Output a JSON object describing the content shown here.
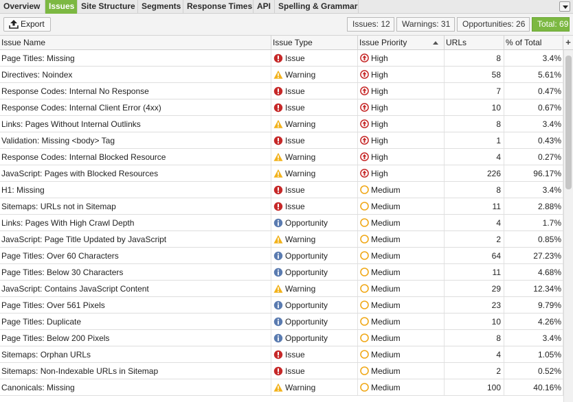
{
  "tabs": [
    {
      "label": "Overview",
      "active": false
    },
    {
      "label": "Issues",
      "active": true
    },
    {
      "label": "Site Structure",
      "active": false
    },
    {
      "label": "Segments",
      "active": false
    },
    {
      "label": "Response Times",
      "active": false
    },
    {
      "label": "API",
      "active": false
    },
    {
      "label": "Spelling & Grammar",
      "active": false
    }
  ],
  "toolbar": {
    "export_label": "Export",
    "counts": {
      "issues": "Issues: 12",
      "warnings": "Warnings: 31",
      "opportunities": "Opportunities: 26",
      "total": "Total: 69"
    }
  },
  "columns": [
    "Issue Name",
    "Issue Type",
    "Issue Priority",
    "URLs",
    "% of Total"
  ],
  "sort": {
    "column": "Issue Priority",
    "direction": "ascending"
  },
  "colors": {
    "accent": "#7cb842",
    "issue": "#c62828",
    "warning": "#f2b21b",
    "opportunity": "#5a7bb0",
    "high": "#c62828",
    "medium": "#f0a818"
  },
  "rows": [
    {
      "name": "Page Titles: Missing",
      "type": "Issue",
      "type_icon": "error-icon",
      "priority": "High",
      "priority_icon": "high-priority-icon",
      "urls": "8",
      "pct": "3.4%"
    },
    {
      "name": "Directives: Noindex",
      "type": "Warning",
      "type_icon": "warning-icon",
      "priority": "High",
      "priority_icon": "high-priority-icon",
      "urls": "58",
      "pct": "5.61%"
    },
    {
      "name": "Response Codes: Internal No Response",
      "type": "Issue",
      "type_icon": "error-icon",
      "priority": "High",
      "priority_icon": "high-priority-icon",
      "urls": "7",
      "pct": "0.47%"
    },
    {
      "name": "Response Codes: Internal Client Error (4xx)",
      "type": "Issue",
      "type_icon": "error-icon",
      "priority": "High",
      "priority_icon": "high-priority-icon",
      "urls": "10",
      "pct": "0.67%"
    },
    {
      "name": "Links: Pages Without Internal Outlinks",
      "type": "Warning",
      "type_icon": "warning-icon",
      "priority": "High",
      "priority_icon": "high-priority-icon",
      "urls": "8",
      "pct": "3.4%"
    },
    {
      "name": "Validation: Missing <body> Tag",
      "type": "Issue",
      "type_icon": "error-icon",
      "priority": "High",
      "priority_icon": "high-priority-icon",
      "urls": "1",
      "pct": "0.43%"
    },
    {
      "name": "Response Codes: Internal Blocked Resource",
      "type": "Warning",
      "type_icon": "warning-icon",
      "priority": "High",
      "priority_icon": "high-priority-icon",
      "urls": "4",
      "pct": "0.27%"
    },
    {
      "name": "JavaScript: Pages with Blocked Resources",
      "type": "Warning",
      "type_icon": "warning-icon",
      "priority": "High",
      "priority_icon": "high-priority-icon",
      "urls": "226",
      "pct": "96.17%"
    },
    {
      "name": "H1: Missing",
      "type": "Issue",
      "type_icon": "error-icon",
      "priority": "Medium",
      "priority_icon": "medium-priority-icon",
      "urls": "8",
      "pct": "3.4%"
    },
    {
      "name": "Sitemaps: URLs not in Sitemap",
      "type": "Issue",
      "type_icon": "error-icon",
      "priority": "Medium",
      "priority_icon": "medium-priority-icon",
      "urls": "11",
      "pct": "2.88%"
    },
    {
      "name": "Links: Pages With High Crawl Depth",
      "type": "Opportunity",
      "type_icon": "info-icon",
      "priority": "Medium",
      "priority_icon": "medium-priority-icon",
      "urls": "4",
      "pct": "1.7%"
    },
    {
      "name": "JavaScript: Page Title Updated by JavaScript",
      "type": "Warning",
      "type_icon": "warning-icon",
      "priority": "Medium",
      "priority_icon": "medium-priority-icon",
      "urls": "2",
      "pct": "0.85%"
    },
    {
      "name": "Page Titles: Over 60 Characters",
      "type": "Opportunity",
      "type_icon": "info-icon",
      "priority": "Medium",
      "priority_icon": "medium-priority-icon",
      "urls": "64",
      "pct": "27.23%"
    },
    {
      "name": "Page Titles: Below 30 Characters",
      "type": "Opportunity",
      "type_icon": "info-icon",
      "priority": "Medium",
      "priority_icon": "medium-priority-icon",
      "urls": "11",
      "pct": "4.68%"
    },
    {
      "name": "JavaScript: Contains JavaScript Content",
      "type": "Warning",
      "type_icon": "warning-icon",
      "priority": "Medium",
      "priority_icon": "medium-priority-icon",
      "urls": "29",
      "pct": "12.34%"
    },
    {
      "name": "Page Titles: Over 561 Pixels",
      "type": "Opportunity",
      "type_icon": "info-icon",
      "priority": "Medium",
      "priority_icon": "medium-priority-icon",
      "urls": "23",
      "pct": "9.79%"
    },
    {
      "name": "Page Titles: Duplicate",
      "type": "Opportunity",
      "type_icon": "info-icon",
      "priority": "Medium",
      "priority_icon": "medium-priority-icon",
      "urls": "10",
      "pct": "4.26%"
    },
    {
      "name": "Page Titles: Below 200 Pixels",
      "type": "Opportunity",
      "type_icon": "info-icon",
      "priority": "Medium",
      "priority_icon": "medium-priority-icon",
      "urls": "8",
      "pct": "3.4%"
    },
    {
      "name": "Sitemaps: Orphan URLs",
      "type": "Issue",
      "type_icon": "error-icon",
      "priority": "Medium",
      "priority_icon": "medium-priority-icon",
      "urls": "4",
      "pct": "1.05%"
    },
    {
      "name": "Sitemaps: Non-Indexable URLs in Sitemap",
      "type": "Issue",
      "type_icon": "error-icon",
      "priority": "Medium",
      "priority_icon": "medium-priority-icon",
      "urls": "2",
      "pct": "0.52%"
    },
    {
      "name": "Canonicals: Missing",
      "type": "Warning",
      "type_icon": "warning-icon",
      "priority": "Medium",
      "priority_icon": "medium-priority-icon",
      "urls": "100",
      "pct": "40.16%"
    }
  ]
}
